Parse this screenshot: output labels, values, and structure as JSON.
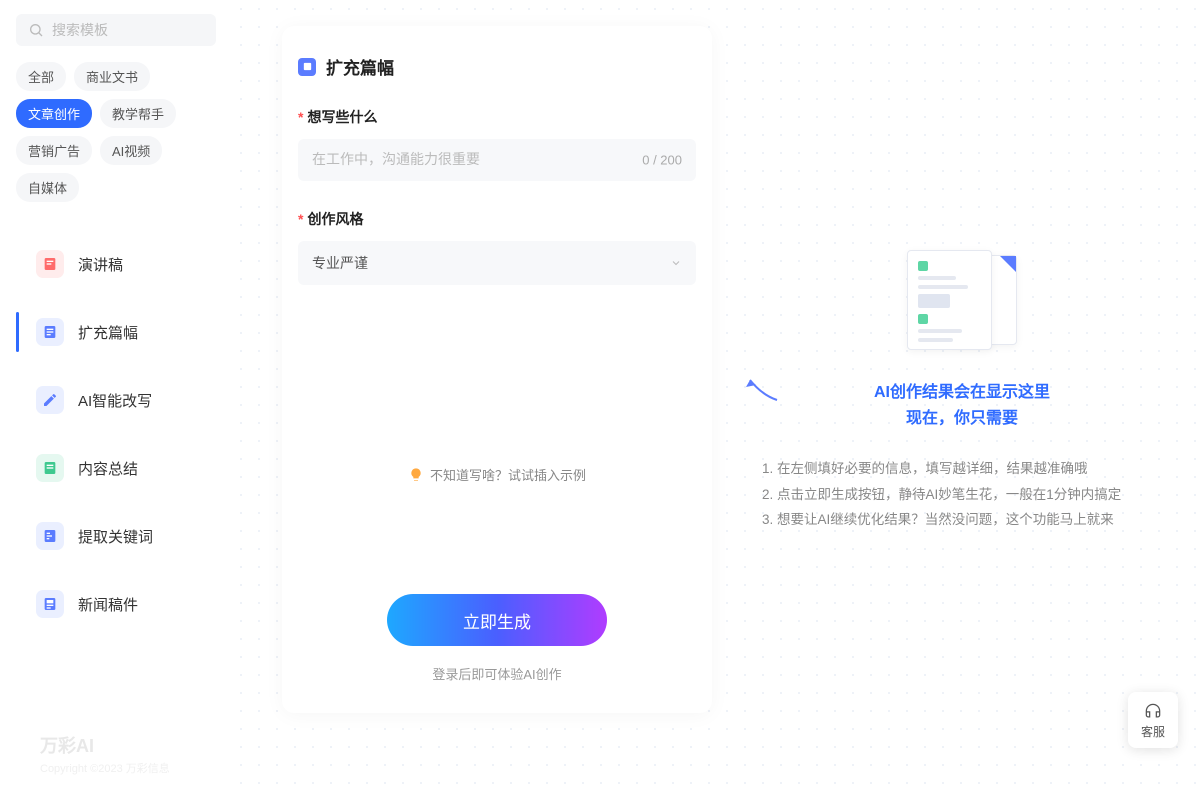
{
  "search": {
    "placeholder": "搜索模板"
  },
  "filters": [
    {
      "label": "全部",
      "active": false
    },
    {
      "label": "商业文书",
      "active": false
    },
    {
      "label": "文章创作",
      "active": true
    },
    {
      "label": "教学帮手",
      "active": false
    },
    {
      "label": "营销广告",
      "active": false
    },
    {
      "label": "AI视频",
      "active": false
    },
    {
      "label": "自媒体",
      "active": false
    }
  ],
  "templates": [
    {
      "label": "演讲稿",
      "color": "#ff6b6b",
      "active": false
    },
    {
      "label": "扩充篇幅",
      "color": "#5b7cff",
      "active": true
    },
    {
      "label": "AI智能改写",
      "color": "#5b7cff",
      "active": false
    },
    {
      "label": "内容总结",
      "color": "#3ec98f",
      "active": false
    },
    {
      "label": "提取关键词",
      "color": "#5b7cff",
      "active": false
    },
    {
      "label": "新闻稿件",
      "color": "#5b7cff",
      "active": false
    }
  ],
  "footer": {
    "brand": "万彩AI",
    "copyright": "Copyright ©2023 万彩信息"
  },
  "panel": {
    "title": "扩充篇幅",
    "field1_label": "想写些什么",
    "field1_placeholder": "在工作中，沟通能力很重要",
    "field1_count": "0 / 200",
    "field2_label": "创作风格",
    "field2_value": "专业严谨",
    "hint": "不知道写啥？试试插入示例",
    "button": "立即生成",
    "login_tip": "登录后即可体验AI创作"
  },
  "result": {
    "title_line1": "AI创作结果会在显示这里",
    "title_line2": "现在，你只需要",
    "steps": [
      "1. 在左侧填好必要的信息，填写越详细，结果越准确哦",
      "2. 点击立即生成按钮，静待AI妙笔生花，一般在1分钟内搞定",
      "3. 想要让AI继续优化结果？当然没问题，这个功能马上就来"
    ]
  },
  "service": {
    "label": "客服"
  }
}
